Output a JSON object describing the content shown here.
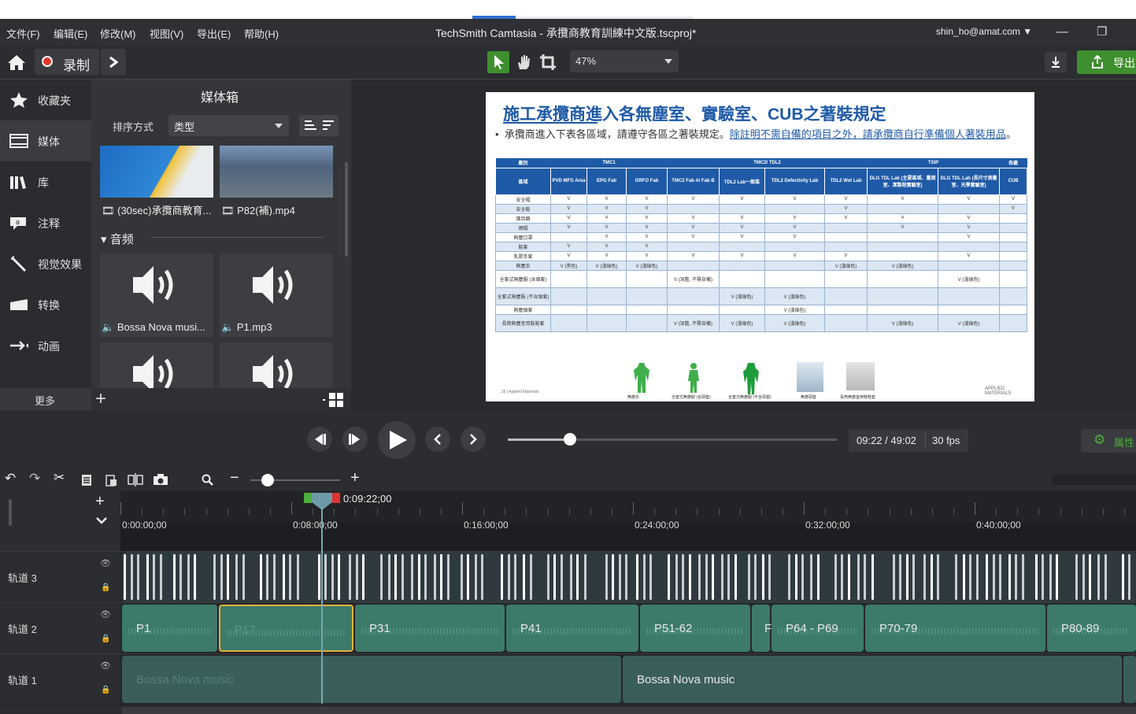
{
  "window": {
    "title": "TechSmith Camtasia - 承攬商教育訓練中文版.tscproj*",
    "user": "shin_ho@amat.com ▼"
  },
  "menu": [
    "文件(F)",
    "编辑(E)",
    "修改(M)",
    "视图(V)",
    "导出(E)",
    "帮助(H)"
  ],
  "toolbar": {
    "record_label": "录制",
    "zoom": "47%",
    "export_label": "导出"
  },
  "sidebar": {
    "items": [
      {
        "label": "收藏夹"
      },
      {
        "label": "媒体"
      },
      {
        "label": "库"
      },
      {
        "label": "注释"
      },
      {
        "label": "视觉效果"
      },
      {
        "label": "转换"
      },
      {
        "label": "动画"
      }
    ],
    "more": "更多"
  },
  "mediabin": {
    "title": "媒体箱",
    "sort_label": "排序方式",
    "sort_value": "类型",
    "videos": [
      {
        "name": "(30sec)承攬商教育..."
      },
      {
        "name": "P82(補).mp4"
      }
    ],
    "audio_header": "音频",
    "audios": [
      {
        "name": "Bossa Nova musi..."
      },
      {
        "name": "P1.mp3"
      }
    ]
  },
  "slide": {
    "title": "施工承攬商進入各無塵室、實驗室、CUB之著裝規定",
    "bullet_plain": "承攬商進入下表各區域，請遵守各區之著裝規定。",
    "bullet_link": "除註明不需自備的項目之外，請承攬商自行準備個人著裝用品",
    "bullet_end": "。",
    "footer_left": "25 | Applied Materials",
    "footer_logo": "APPLIED MATERIALS",
    "table": {
      "group_header": [
        "廠別",
        "TMC1",
        "TMC2/ TDL2",
        "TSIP",
        "各廠"
      ],
      "col_header": [
        "區域",
        "PVD MFG Area",
        "EPG Fab",
        "GRFO Fab",
        "TMC2 Fab A/ Fab B",
        "TDL2 Lab一般區",
        "TDL2 Defectivity Lab",
        "TDL2 Wet Lab",
        "DLG TDL Lab (主要區域、量測室、潔製程實驗室)",
        "DLG TDL Lab (長尺寸測量室、光學實驗室)",
        "CUB"
      ],
      "rows": [
        [
          "安全帽",
          "V",
          "V",
          "V",
          "V",
          "V",
          "V",
          "V",
          "V",
          "V",
          "V"
        ],
        [
          "安全鞋",
          "V",
          "V",
          "V",
          "",
          "",
          "",
          "V",
          "",
          "",
          "V"
        ],
        [
          "護目鏡",
          "V",
          "V",
          "V",
          "V",
          "V",
          "V",
          "V",
          "V",
          "V",
          ""
        ],
        [
          "網帽",
          "V",
          "V",
          "V",
          "V",
          "V",
          "V",
          "",
          "V",
          "V",
          ""
        ],
        [
          "無塵口罩",
          "",
          "V",
          "V",
          "V",
          "V",
          "V",
          "",
          "",
          "V",
          ""
        ],
        [
          "鞋套",
          "V",
          "V",
          "V",
          "",
          "",
          "",
          "",
          "",
          "",
          ""
        ],
        [
          "乳膠手套",
          "V",
          "V",
          "V",
          "V",
          "V",
          "V",
          "V",
          "",
          "V",
          ""
        ],
        [
          "無塵衣",
          "V (黑色)",
          "V (淺綠色)",
          "V (淺綠色)",
          "",
          "",
          "",
          "V (淺綠色)",
          "V (淺綠色)",
          "",
          ""
        ],
        [
          "全套式無塵服 (含頭套)",
          "",
          "",
          "",
          "V (深藍, 不需自備)",
          "",
          "",
          "",
          "",
          "V (淺綠色)",
          ""
        ],
        [
          "全套式無塵服 (不含頭套)",
          "",
          "",
          "",
          "",
          "V (淺綠色)",
          "V (淺綠色)",
          "",
          "",
          "",
          ""
        ],
        [
          "無塵頭套",
          "",
          "",
          "",
          "",
          "",
          "V (淺綠色)",
          "",
          "",
          "",
          ""
        ],
        [
          "長筒無塵室用鞋鞋套",
          "",
          "",
          "",
          "V (深藍, 不需自備)",
          "V (淺綠色)",
          "V (淺綠色)",
          "",
          "V (淺綠色)",
          "V (淺綠色)",
          ""
        ]
      ]
    },
    "captions": [
      "無塵衣",
      "全套式無塵服 (含頭套)",
      "全套式無塵服 (不含頭套)",
      "無塵頭套",
      "長筒無塵室用鞋鞋套"
    ]
  },
  "playback": {
    "time": "09:22 / 49:02",
    "fps": "30 fps",
    "properties": "属性",
    "progress": 0.19
  },
  "timeline": {
    "playhead": "0:09:22;00",
    "ticks": [
      "0:00:00;00",
      "0:08:00;00",
      "0:16:00;00",
      "0:24:00;00",
      "0:32:00;00",
      "0:40:00;00"
    ],
    "tracks": [
      {
        "label": "轨道 3"
      },
      {
        "label": "轨道 2",
        "clips": [
          "P1",
          "P17",
          "P31",
          "P41",
          "P51-62",
          "F",
          "P64 - P69",
          "P70-79",
          "P80-89"
        ]
      },
      {
        "label": "轨道 1",
        "clips": [
          "Bossa Nova  music",
          "Bossa Nova  music"
        ]
      }
    ]
  },
  "colors": {
    "accent_green": "#3f8f2f",
    "clip_teal": "#3d7a6a",
    "slide_title": "#1f5aa6",
    "table_header": "#1f5aa6"
  }
}
